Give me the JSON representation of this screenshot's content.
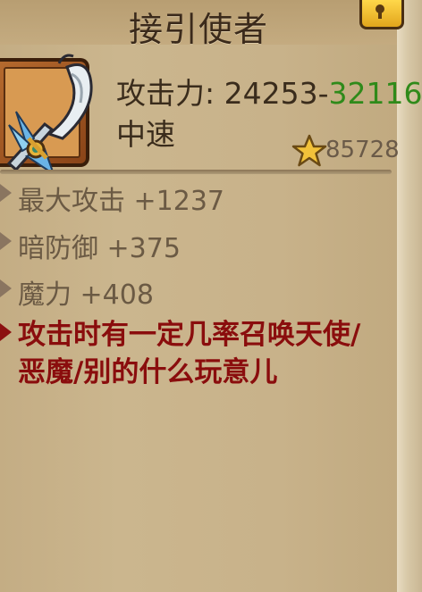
{
  "header": {
    "title": "接引使者"
  },
  "item": {
    "attack_label": "攻击力: ",
    "attack_min": "24253",
    "attack_separator": "-",
    "attack_max": "32116",
    "speed": "中速",
    "rating": "85728"
  },
  "attributes": [
    {
      "text": "最大攻击 +1237"
    },
    {
      "text": "暗防御 +375"
    },
    {
      "text": "魔力 +408"
    }
  ],
  "special_effect": "攻击时有一定几率召唤天使/恶魔/别的什么玩意儿",
  "colors": {
    "attack_max": "#2f8a1a",
    "special_effect": "#8a0d0d",
    "attribute_text": "#6b5a44"
  },
  "icons": {
    "lock": "lock-icon",
    "star": "star-icon",
    "weapon": "weapon-icon"
  }
}
